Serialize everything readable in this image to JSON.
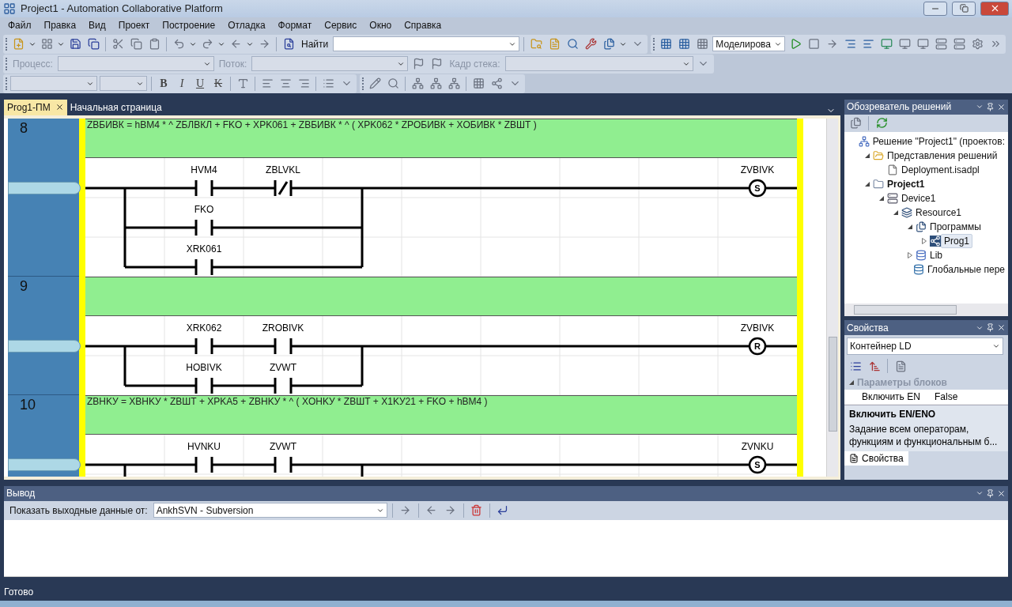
{
  "window": {
    "title": "Project1 - Automation Collaborative Platform"
  },
  "menu": [
    "Файл",
    "Правка",
    "Вид",
    "Проект",
    "Построение",
    "Отладка",
    "Формат",
    "Сервис",
    "Окно",
    "Справка"
  ],
  "toolbar": {
    "find_label": "Найти",
    "mode": "Моделирова",
    "process_label": "Процесс:",
    "thread_label": "Поток:",
    "stack_label": "Кадр стека:",
    "format_buttons": [
      {
        "label": "B",
        "kind": "bold"
      },
      {
        "label": "I",
        "kind": "italic"
      },
      {
        "label": "U",
        "kind": "underline"
      },
      {
        "label": "K",
        "kind": "strike"
      }
    ]
  },
  "editor": {
    "tabs": [
      {
        "label": "Prog1-ПМ",
        "selected": true
      },
      {
        "label": "Начальная страница",
        "selected": false
      }
    ],
    "rungs": [
      {
        "number": "8",
        "comment": "ZBБИВК = hBM4 * ^ ZБЛВКЛ + FKO + XPK061 + ZBБИВК * ^ ( XPK062 * ZPOБИВК + XOБИВК * ZBШТ )",
        "branches": [
          [
            {
              "label": "HVM4",
              "kind": "no"
            },
            {
              "label": "ZBLVKL",
              "kind": "nc"
            }
          ],
          [
            {
              "label": "FKO",
              "kind": "no"
            }
          ],
          [
            {
              "label": "XRK061",
              "kind": "no"
            }
          ]
        ],
        "coil": {
          "label": "ZVBIVK",
          "symbol": "S"
        },
        "continued": false
      },
      {
        "number": "9",
        "branches": [
          [
            {
              "label": "XRK062",
              "kind": "no"
            },
            {
              "label": "ZROBIVK",
              "kind": "no"
            }
          ],
          [
            {
              "label": "HOBIVK",
              "kind": "no"
            },
            {
              "label": "ZVWT",
              "kind": "no"
            }
          ]
        ],
        "coil": {
          "label": "ZVBIVK",
          "symbol": "R"
        },
        "continued": false
      },
      {
        "number": "10",
        "comment": "ZBHKУ = XBHKУ * ZBШТ + XPKA5 + ZBHKУ * ^ ( XOHKУ * ZBШТ + X1KУ21 + FKO + hBM4 )",
        "branches": [
          [
            {
              "label": "HVNKU",
              "kind": "no"
            },
            {
              "label": "ZVWT",
              "kind": "no"
            }
          ]
        ],
        "coil": {
          "label": "ZVNKU",
          "symbol": "S"
        },
        "continued": true
      }
    ]
  },
  "solution_explorer": {
    "title": "Обозреватель решений",
    "tree": [
      {
        "label": "Решение \"Project1\"  (проектов:",
        "kind": "solution",
        "selected": false,
        "children": [
          {
            "label": "Представления решений",
            "kind": "folder",
            "expanded": true,
            "selected": false,
            "children": [
              {
                "label": "Deployment.isadpl",
                "kind": "file",
                "selected": false
              }
            ]
          },
          {
            "label": "Project1",
            "kind": "project",
            "bold": true,
            "expanded": true,
            "selected": false,
            "children": [
              {
                "label": "Device1",
                "kind": "device",
                "expanded": true,
                "selected": false,
                "children": [
                  {
                    "label": "Resource1",
                    "kind": "resource",
                    "expanded": true,
                    "selected": false,
                    "children": [
                      {
                        "label": "Программы",
                        "kind": "programs",
                        "expanded": true,
                        "selected": false,
                        "children": [
                          {
                            "label": "Prog1",
                            "kind": "program",
                            "expanded": false,
                            "selected": true
                          }
                        ]
                      },
                      {
                        "label": "Lib",
                        "kind": "library",
                        "expanded": false,
                        "selected": false
                      },
                      {
                        "label": "Глобальные пере",
                        "kind": "globals",
                        "selected": false
                      }
                    ]
                  }
                ]
              }
            ]
          }
        ]
      }
    ]
  },
  "properties": {
    "title": "Свойства",
    "object": "Контейнер LD",
    "category": "Параметры блоков",
    "category_expanded": true,
    "rows": [
      {
        "name": "Включить EN",
        "value": "False"
      }
    ],
    "description_title": "Включить EN/ENO",
    "description": "Задание всем операторам, функциям и функциональным б...",
    "tab": "Свойства"
  },
  "output": {
    "title": "Вывод",
    "source_label": "Показать выходные данные от:",
    "source": "AnkhSVN - Subversion"
  },
  "status_bar": "Готово"
}
